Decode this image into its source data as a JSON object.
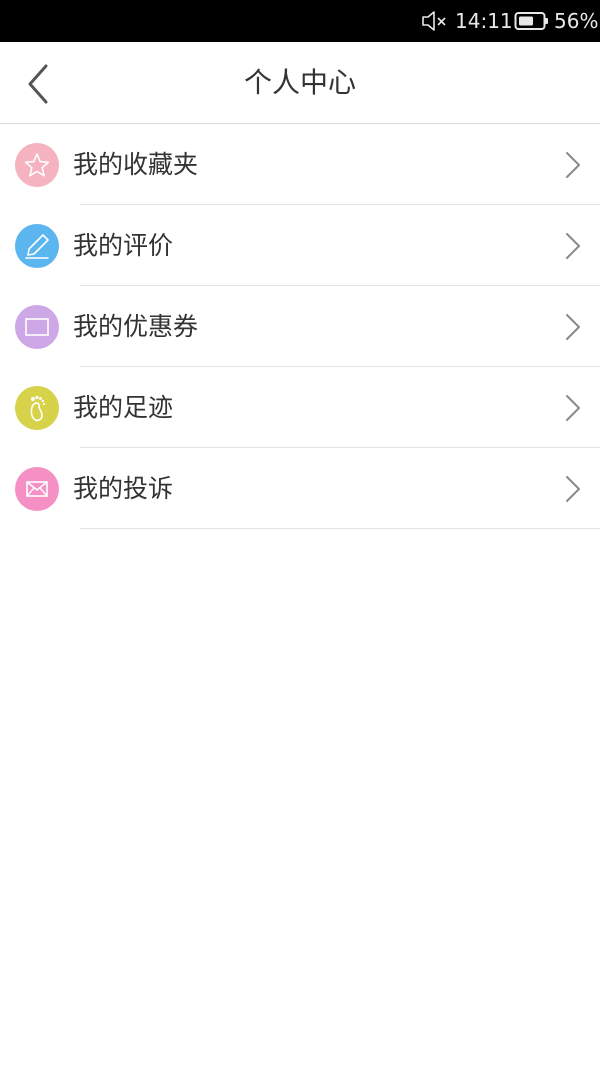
{
  "status_bar": {
    "time": "14:11",
    "battery": "56%",
    "icons": [
      "mute-icon",
      "battery-icon"
    ]
  },
  "nav": {
    "title": "个人中心",
    "back_icon": "chevron-left-icon"
  },
  "menu": {
    "items": [
      {
        "label": "我的收藏夹",
        "icon": "star-icon",
        "color": "#f5b3c0"
      },
      {
        "label": "我的评价",
        "icon": "pencil-icon",
        "color": "#5bb5ee"
      },
      {
        "label": "我的优惠券",
        "icon": "coupon-icon",
        "color": "#cda7e6"
      },
      {
        "label": "我的足迹",
        "icon": "footprint-icon",
        "color": "#d6d24a"
      },
      {
        "label": "我的投诉",
        "icon": "envelope-icon",
        "color": "#f590c4"
      }
    ],
    "chevron_icon": "chevron-right-icon"
  },
  "colors": {
    "status_bar_bg": "#000000",
    "divider": "#e2e2e2",
    "text": "#333333"
  }
}
